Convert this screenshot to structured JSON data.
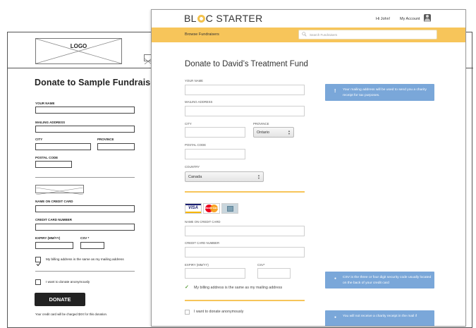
{
  "wireframe": {
    "logo_text": "LOGO",
    "title": "Donate to Sample Fundraiser Title",
    "labels": {
      "your_name": "YOUR NAME",
      "mailing_address": "MAILING ADDRESS",
      "city": "CITY",
      "province": "PROVINCE",
      "postal_code": "POSTAL CODE",
      "name_on_card": "NAME ON CREDIT CARD",
      "card_number": "CREDIT CARD NUMBER",
      "expiry": "EXPIRY (MM/YY)",
      "csv": "CSV *"
    },
    "billing_checkbox": "My billing address is the same as my mailing address",
    "anonymous_checkbox": "I want to donate anonymously",
    "donate_button": "DONATE",
    "note": "Your credit card will be charged $XX for this donation."
  },
  "mockup": {
    "brand": {
      "prefix": "BL",
      "suffix": "C STARTER"
    },
    "greeting": "Hi John!",
    "my_account": "My Account",
    "nav_link": "Browse Fundraisers",
    "search_placeholder": "Search Fundraisers",
    "title": "Donate to David’s Treatment Fund",
    "labels": {
      "your_name": "YOUR NAME",
      "mailing_address": "MAILING ADDRESS",
      "city": "CITY",
      "province": "PROVINCE",
      "postal_code": "POSTAL CODE",
      "country": "COUNTRY",
      "name_on_card": "NAME ON CREDIT CARD",
      "card_number": "CREDIT CARD NUMBER",
      "expiry": "EXPIRY (MM/YY)",
      "csv": "CSV*"
    },
    "province_value": "Ontario",
    "country_value": "Canada",
    "cards": {
      "visa": "VISA",
      "mastercard": "MasterCard"
    },
    "billing_checkbox": "My billing address is the same as my mailing address",
    "anonymous_checkbox": "I want to donate anonymously",
    "info_boxes": {
      "mailing": "Your mailing address will be used to send you a charity receipt for tax purposes.",
      "csv": "CSV is the three or four digit security code usually located on the back of your credit card",
      "receipt": "You will not receive a charity receipt in the mail if"
    },
    "colors": {
      "accent_yellow": "#f7c55a",
      "info_blue": "#7aa7d9",
      "check_green": "#5a9d3c"
    }
  }
}
